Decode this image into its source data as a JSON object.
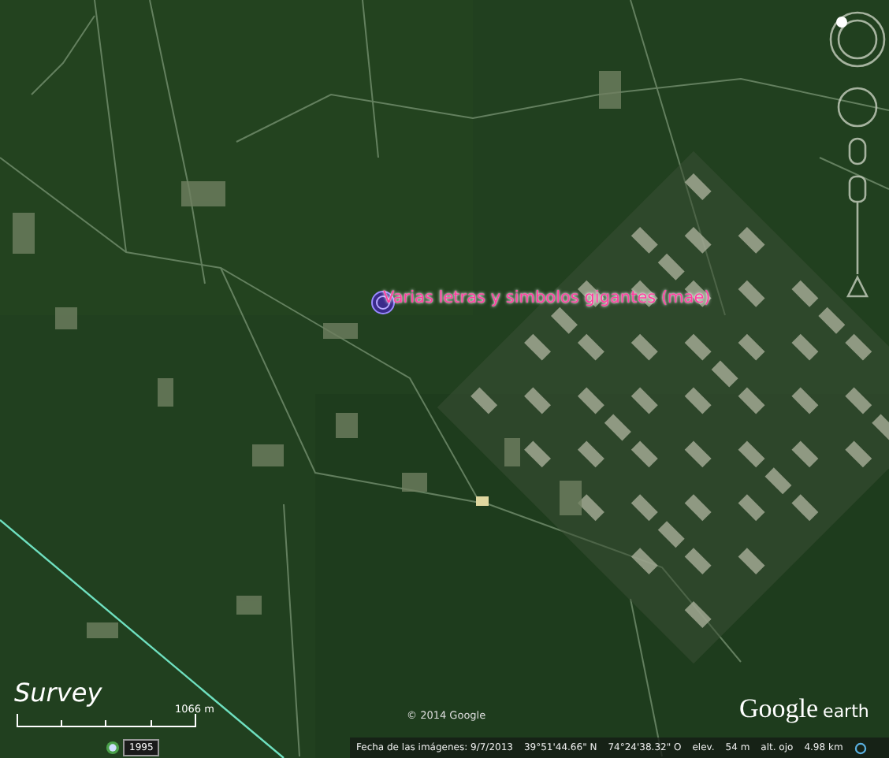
{
  "placemark": {
    "label": "Varias letras y simbolos gigantes (mae)"
  },
  "logo": {
    "text": "Survey"
  },
  "scale": {
    "label": "1066 m"
  },
  "history": {
    "year": "1995"
  },
  "copyright": "© 2014 Google",
  "brand": {
    "word_1": "Google",
    "word_2": "earth"
  },
  "status_bar": {
    "imagery_date": "Fecha de las imágenes: 9/7/2013",
    "latitude": "39°51'44.66\" N",
    "longitude": "74°24'38.32\" O",
    "elevation_label": "elev.",
    "elevation": "54 m",
    "eye_alt_label": "alt. ojo",
    "eye_alt": "4.98 km"
  }
}
